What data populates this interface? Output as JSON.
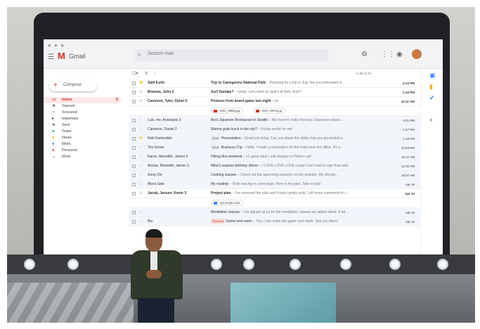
{
  "window": {
    "controls": "● ● ●"
  },
  "app": {
    "name": "Gmail",
    "logo": "M"
  },
  "search": {
    "placeholder": "Search mail"
  },
  "toolbar": {
    "pagination": "1–50 of 74"
  },
  "compose": {
    "label": "Compose"
  },
  "sidebar": {
    "items": [
      {
        "label": "Inbox",
        "icon": "inbox-icon",
        "count": "8"
      },
      {
        "label": "Starred",
        "icon": "star-icon"
      },
      {
        "label": "Snoozed",
        "icon": "clock-icon"
      },
      {
        "label": "Important",
        "icon": "important-icon"
      },
      {
        "label": "Sent",
        "icon": "send-icon"
      },
      {
        "label": "Team",
        "icon": "label-icon"
      },
      {
        "label": "News",
        "icon": "label-icon"
      },
      {
        "label": "Work",
        "icon": "label-icon"
      },
      {
        "label": "Personal",
        "icon": "label-icon"
      },
      {
        "label": "More",
        "icon": "chevron-down-icon"
      }
    ]
  },
  "emails": [
    {
      "sender": "Salil Kulin",
      "subject": "Trip to Cairngorms National Park",
      "snippet": " – Planning for a trip in July. Are you interested in ...",
      "time": "2:13 PM",
      "unread": true,
      "starred": true
    },
    {
      "sender": "Brianna, John 2",
      "subject": "Surf Sunday?",
      "snippet": " – Great. Let's meet at Jack's at 8am, then?",
      "time": "2:10 PM",
      "unread": true,
      "starred": false
    },
    {
      "sender": "Cameron, Tyler, Dylan 6",
      "subject": "Pictures from board game last night",
      "snippet": " – lol",
      "time": "10:11 AM",
      "unread": true,
      "starred": false
    },
    {
      "sender": "Luis, me, Anastasia 3",
      "subject": "Best Japanese Restaurant in Seattle",
      "snippet": " – We haven't really tried any Japanese places...",
      "time": "2:21 PM",
      "unread": false,
      "starred": false
    },
    {
      "sender": "Cameron, Daniel 2",
      "subject": "Wanna grab lunch in the city?",
      "snippet": " – Friday works for me!",
      "time": "1:47 PM",
      "unread": false,
      "starred": false
    },
    {
      "sender": "Nick Kortendick",
      "tag": "Work",
      "subject": "Presentation",
      "snippet": " – Great job today. Can you share the slides that you presented a...",
      "time": "1:19 PM",
      "unread": false,
      "starred": true
    },
    {
      "sender": "Tim Green",
      "tag": "Work",
      "subject": "Business Trip",
      "snippet": " – Hello, I made a reservation for the hotel near the office. It's a...",
      "time": "12:23 PM",
      "unread": false,
      "starred": false
    },
    {
      "sender": "Karen, Meredith, James 3",
      "subject": "Hiking this weekend",
      "snippet": " – +1 great idea! I call shotgun in Peter's car!",
      "time": "11:37 AM",
      "unread": false,
      "starred": false
    },
    {
      "sender": "Anissa, Meredith, James 3",
      "subject": "Mike's surprise birthday dinner",
      "snippet": " – I LOVE LOVE LOVE corgis! Can't wait to sign that card.",
      "time": "11:32 AM",
      "unread": false,
      "starred": false
    },
    {
      "sender": "Song Chi",
      "subject": "Cooking classes",
      "snippet": " – Check out the upcoming sessions on the website. We should...",
      "time": "10:07 AM",
      "unread": false,
      "starred": false
    },
    {
      "sender": "Mizra Sato",
      "subject": "My roadtrip",
      "snippet": " – I'll be leaving in a few days. Here is my plan. Take a look!",
      "time": "Apr 26",
      "unread": false,
      "starred": false
    },
    {
      "sender": "Jacob, Jensen, Kevin 3",
      "subject": "Project plan",
      "snippet": " – I've reviewed the plan and it looks pretty solid. Left some comments in t...",
      "time": "Apr 24",
      "unread": true,
      "starred": false
    },
    {
      "sender": "",
      "subject": "Meditation classes",
      "snippet": " – I've signed up us for the meditation classes we talked about. It wil...",
      "time": "Apr 24",
      "unread": false,
      "starred": false
    },
    {
      "sender": "Bry",
      "tag": "Personal",
      "subject": "Game next week",
      "snippet": " – Yes, I can make the game next week. See you there!",
      "time": "Apr 23",
      "unread": false,
      "starred": false
    }
  ],
  "attachments": {
    "pictures": [
      "IMG_0956.jpg",
      "IMG_0976.jpg"
    ],
    "project": [
      "Q2 project pla"
    ]
  }
}
